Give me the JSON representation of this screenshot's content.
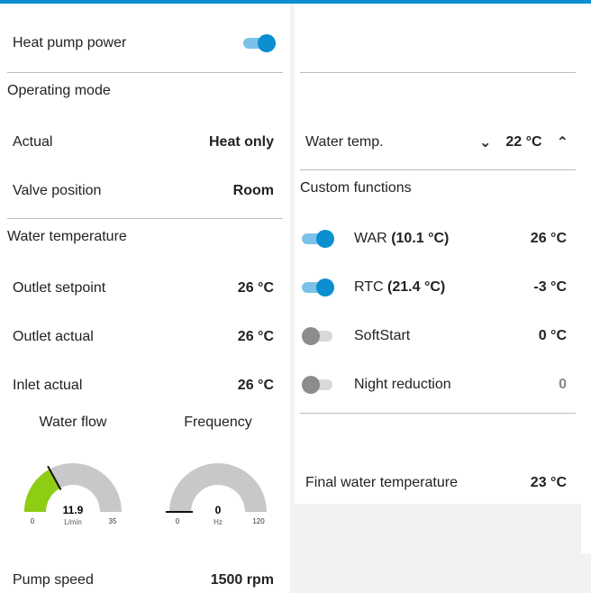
{
  "power": {
    "label": "Heat pump power",
    "on": true
  },
  "operating_mode": {
    "title": "Operating mode",
    "actual_label": "Actual",
    "actual_value": "Heat only",
    "valve_label": "Valve position",
    "valve_value": "Room"
  },
  "water_temperature": {
    "title": "Water temperature",
    "outlet_setpoint_label": "Outlet setpoint",
    "outlet_setpoint_value": "26 °C",
    "outlet_actual_label": "Outlet actual",
    "outlet_actual_value": "26 °C",
    "inlet_actual_label": "Inlet actual",
    "inlet_actual_value": "26 °C"
  },
  "gauges": {
    "water_flow": {
      "title": "Water flow",
      "value": 11.9,
      "value_text": "11.9",
      "unit": "L/min",
      "min": 0,
      "max": 35,
      "min_text": "0",
      "max_text": "35",
      "fill_color": "#8fcc14"
    },
    "frequency": {
      "title": "Frequency",
      "value": 0,
      "value_text": "0",
      "unit": "Hz",
      "min": 0,
      "max": 120,
      "min_text": "0",
      "max_text": "120",
      "fill_color": "#8fcc14"
    }
  },
  "pump": {
    "label": "Pump speed",
    "value": "1500 rpm"
  },
  "water_temp_setting": {
    "label": "Water temp.",
    "value": "22 °C"
  },
  "custom_functions": {
    "title": "Custom functions",
    "items": [
      {
        "name": "WAR",
        "detail": "(10.1 °C)",
        "value": "26 °C",
        "on": true
      },
      {
        "name": "RTC",
        "detail": "(21.4 °C)",
        "value": "-3 °C",
        "on": true
      },
      {
        "name": "SoftStart",
        "detail": "",
        "value": "0 °C",
        "on": false
      },
      {
        "name": "Night reduction",
        "detail": "",
        "value": "0",
        "on": false
      }
    ]
  },
  "final": {
    "label": "Final water temperature",
    "value": "23 °C"
  },
  "colors": {
    "accent": "#0b8fd0",
    "accent_light": "#7cc2e8",
    "gauge_fill": "#8fcc14",
    "gauge_bg": "#c8c8c8"
  }
}
